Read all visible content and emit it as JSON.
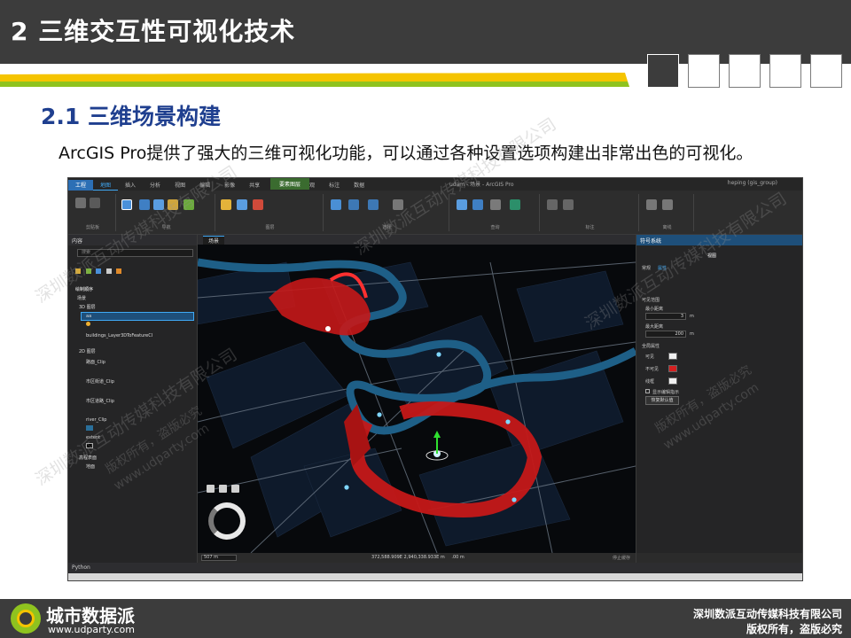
{
  "slide": {
    "title": "2 三维交互性可视化技术",
    "section_title": "2.1 三维场景构建",
    "intro_text": "ArcGIS Pro提供了强大的三维可视化功能，可以通过各种设置选项构建出非常出色的可视化。",
    "colors": {
      "header_bg": "#3c3c3c",
      "accent_blue": "#1f3f8f",
      "stripe_yellow": "#f5c400",
      "stripe_green": "#8fc31f"
    }
  },
  "app": {
    "ribbon_tabs": [
      "工程",
      "地图",
      "插入",
      "分析",
      "视图",
      "编辑",
      "影像",
      "共享",
      "加载项",
      "外观",
      "标注",
      "数据"
    ],
    "context_tab": "要素图层",
    "window_title": "udam - 场景 - ArcGIS Pro",
    "user": "heping (gis_group)",
    "ribbon_groups": [
      "剪贴板",
      "导航",
      "图层",
      "选择",
      "查询",
      "标注",
      "离线"
    ],
    "contents": {
      "title": "内容",
      "search_placeholder": "搜索",
      "drawing_order": "绘制顺序",
      "scene_name": "场景",
      "groups": [
        "3D 图层",
        "2D 图层",
        "高程表面"
      ],
      "layers": [
        "aa",
        "buildings_Layer3DToFeatureCl",
        "路面_Clip",
        "市区街道_Clip",
        "市区道路_Clip",
        "river_Clip",
        "extent",
        "地面"
      ]
    },
    "scene_tab": "场景",
    "status": {
      "scale": "507 m",
      "coords": "372,588.909E 2,940,338.933E m",
      "height": ".00 m",
      "cache": "停止缓存"
    },
    "python_tab": "Python",
    "properties_pane": {
      "title": "符号系统",
      "layer_label": "视图",
      "tabs": [
        "常规",
        "属性"
      ],
      "visibility_label": "可见范围",
      "min_label": "最小距离",
      "min_value": "3",
      "max_label": "最大距离",
      "max_value": "200",
      "unit": "m",
      "section_label": "全局属性",
      "visible_label": "可见",
      "invisible_label": "不可见",
      "outline_label": "线框",
      "checkbox_label": "显示编辑指示",
      "reset_button": "恢复默认值",
      "fill_color": "#d42020"
    }
  },
  "watermarks": [
    "深圳数派互动传媒科技有限公司",
    "深圳数派互动传媒科技有限公司",
    "深圳数派互动传媒科技有限公司",
    "深圳数派互动传媒科技有限公司",
    "版权所有，盗版必究",
    "www.udparty.com",
    "版权所有，盗版必究",
    "www.udparty.com"
  ],
  "footer": {
    "brand_name": "城市数据派",
    "brand_url": "www.udparty.com",
    "company": "深圳数派互动传媒科技有限公司",
    "copyright": "版权所有，盗版必究"
  }
}
